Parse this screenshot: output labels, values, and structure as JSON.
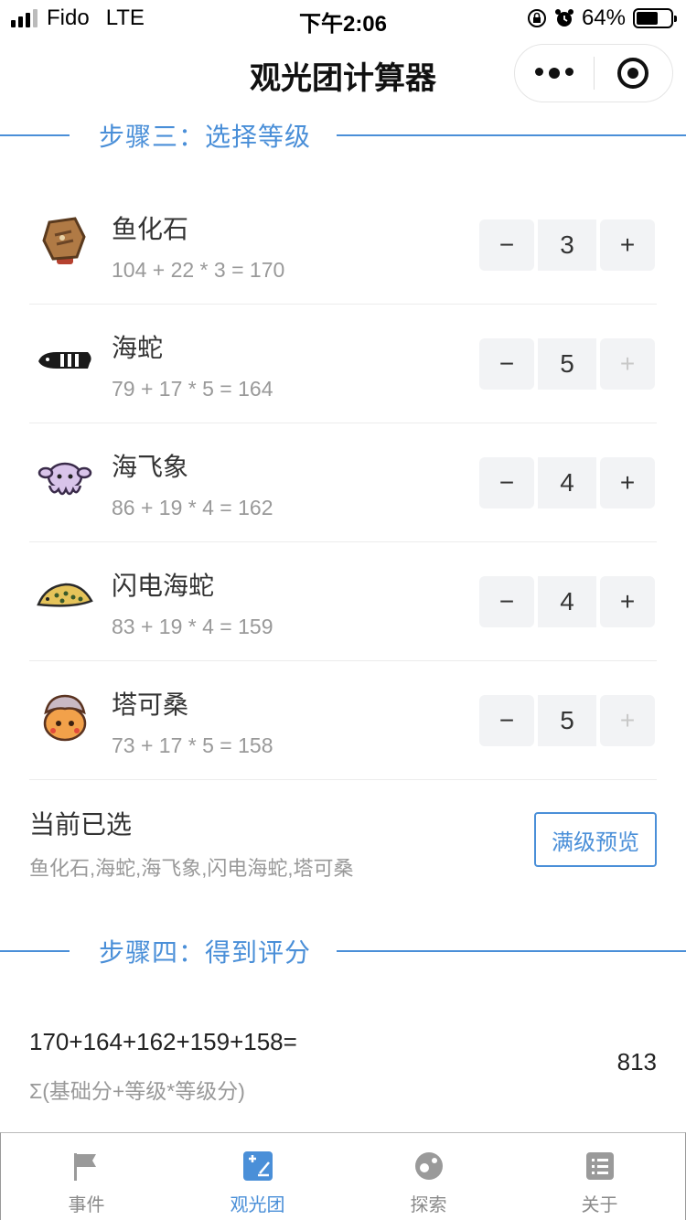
{
  "status_bar": {
    "carrier": "Fido",
    "network": "LTE",
    "time": "下午2:06",
    "battery_percent": "64%",
    "battery_level": 0.64
  },
  "nav": {
    "title": "观光团计算器",
    "more_icon": "more-dots-icon",
    "close_icon": "target-icon"
  },
  "step3": {
    "title": "步骤三：选择等级"
  },
  "items": [
    {
      "name": "鱼化石",
      "formula": "104 + 22 * 3 = 170",
      "level": "3",
      "minus": "−",
      "plus": "+",
      "plus_disabled": false,
      "icon": "fish-fossil-icon"
    },
    {
      "name": "海蛇",
      "formula": "79 + 17 * 5 = 164",
      "level": "5",
      "minus": "−",
      "plus": "+",
      "plus_disabled": true,
      "icon": "sea-snake-icon"
    },
    {
      "name": "海飞象",
      "formula": "86 + 19 * 4 = 162",
      "level": "4",
      "minus": "−",
      "plus": "+",
      "plus_disabled": false,
      "icon": "dumbo-octopus-icon"
    },
    {
      "name": "闪电海蛇",
      "formula": "83 + 19 * 4 = 159",
      "level": "4",
      "minus": "−",
      "plus": "+",
      "plus_disabled": false,
      "icon": "lightning-eel-icon"
    },
    {
      "name": "塔可桑",
      "formula": "73 + 17 * 5 = 158",
      "level": "5",
      "minus": "−",
      "plus": "+",
      "plus_disabled": true,
      "icon": "takosan-icon"
    }
  ],
  "selected": {
    "title": "当前已选",
    "names": "鱼化石,海蛇,海飞象,闪电海蛇,塔可桑",
    "preview_button": "满级预览"
  },
  "step4": {
    "title": "步骤四：得到评分"
  },
  "score": {
    "expression": "170+164+162+159+158=",
    "formula": "Σ(基础分+等级*等级分)",
    "total": "813"
  },
  "tabs": [
    {
      "label": "事件",
      "icon": "flag-icon",
      "active": false
    },
    {
      "label": "观光团",
      "icon": "calculator-icon",
      "active": true
    },
    {
      "label": "探索",
      "icon": "explore-icon",
      "active": false
    },
    {
      "label": "关于",
      "icon": "list-icon",
      "active": false
    }
  ],
  "colors": {
    "accent": "#4a8fd8",
    "text": "#333333",
    "muted": "#999999",
    "stepper_bg": "#f2f3f5"
  }
}
